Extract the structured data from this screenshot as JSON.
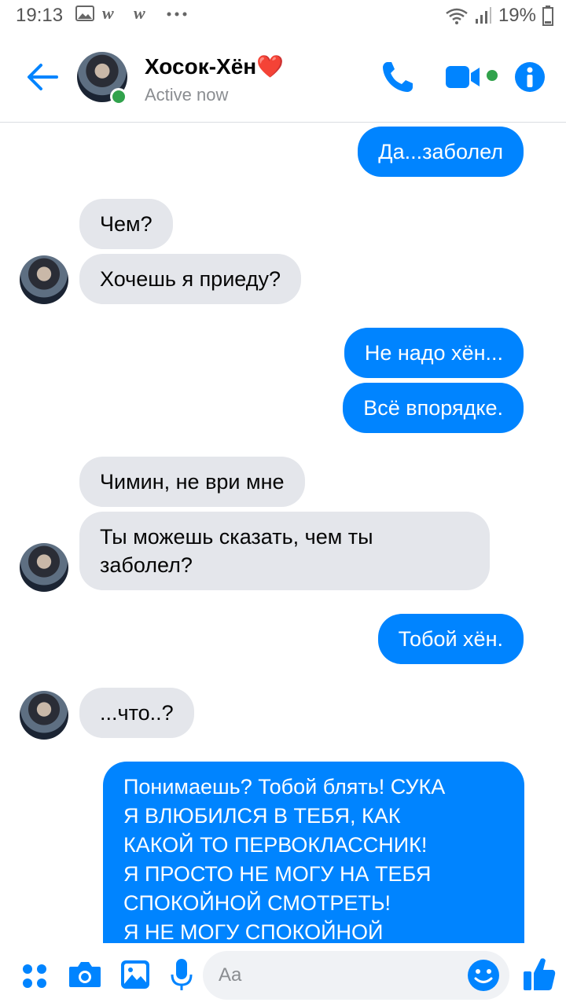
{
  "status_bar": {
    "time": "19:13",
    "battery": "19%",
    "icons": [
      "gallery-icon",
      "w-app-icon",
      "w-app-icon",
      "more-dots-icon",
      "wifi-icon",
      "signal-icon",
      "battery-icon"
    ]
  },
  "header": {
    "contact_name": "Хосок-Хён❤️",
    "status": "Active now",
    "accent_color": "#0084ff"
  },
  "messages": [
    {
      "direction": "outgoing",
      "text": "Да...заболел"
    },
    {
      "direction": "incoming",
      "text": "Чем?"
    },
    {
      "direction": "incoming",
      "text": "Хочешь я приеду?"
    },
    {
      "direction": "outgoing",
      "text": "Не надо хён..."
    },
    {
      "direction": "outgoing",
      "text": "Всё впорядке."
    },
    {
      "direction": "incoming",
      "text": "Чимин, не ври мне"
    },
    {
      "direction": "incoming",
      "text": "Ты можешь сказать, чем ты\nзаболел?"
    },
    {
      "direction": "outgoing",
      "text": "Тобой хён."
    },
    {
      "direction": "incoming",
      "text": "...что..?"
    },
    {
      "direction": "outgoing",
      "text": "Понимаешь? Тобой блять! СУКА\nЯ ВЛЮБИЛСЯ В ТЕБЯ, КАК\nКАКОЙ ТО ПЕРВОКЛАССНИК!\nЯ ПРОСТО НЕ МОГУ НА ТЕБЯ\nСПОКОЙНОЙ СМОТРЕТЬ!\nЯ НЕ МОГУ СПОКОЙНОЙ"
    }
  ],
  "composer": {
    "placeholder": "Aa"
  }
}
